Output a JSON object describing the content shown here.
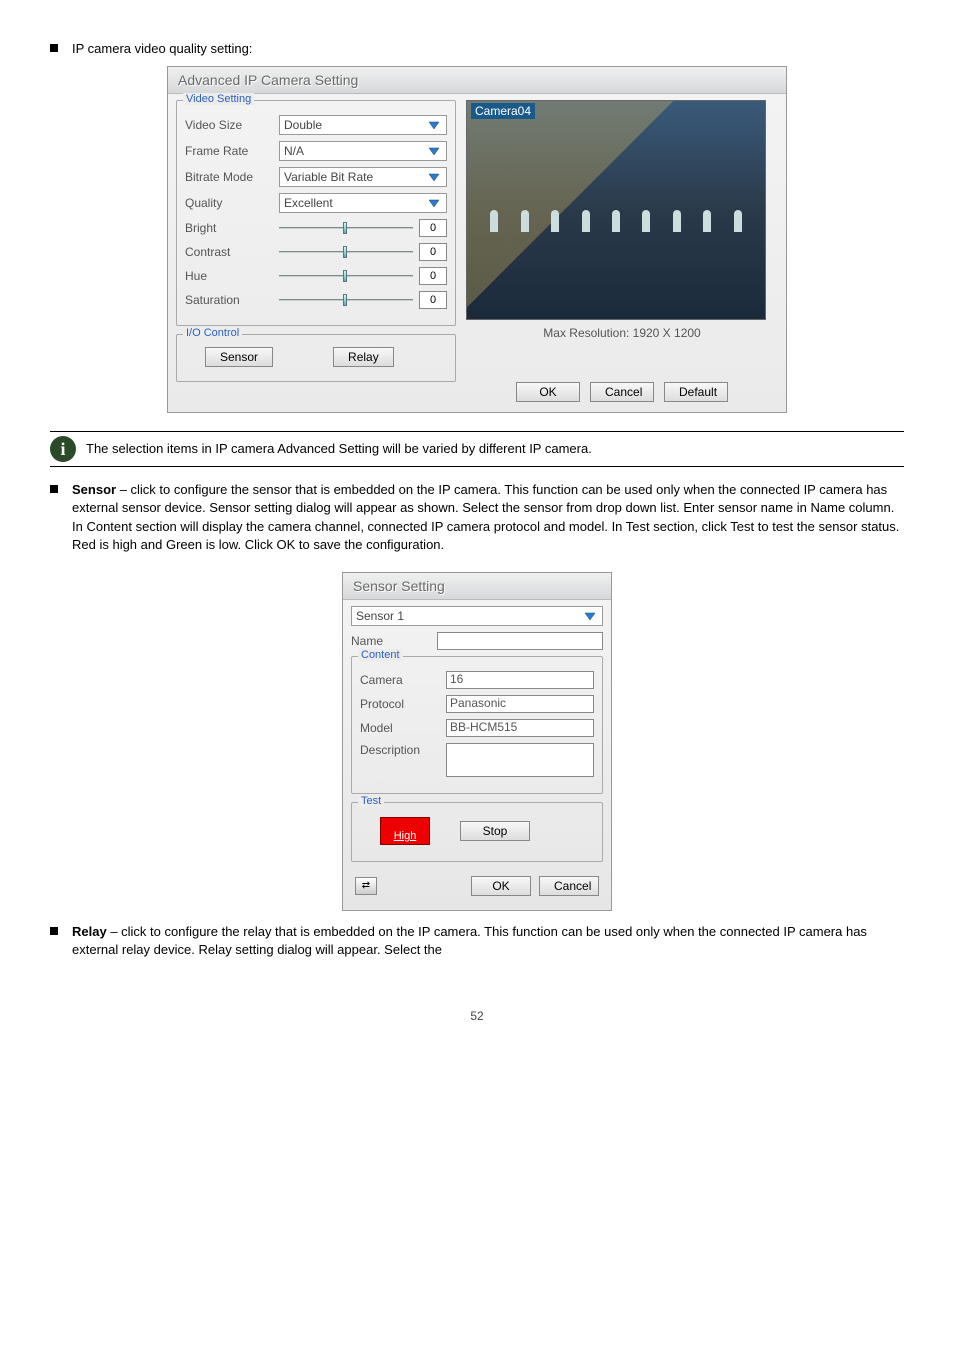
{
  "bullets": {
    "b1": "IP camera video quality setting:",
    "b3_prefix": "Sensor",
    "b3_text": " – click to configure the sensor that is embedded on the IP camera. This function can be used only when the connected IP camera has external sensor device. Sensor setting dialog will appear as shown. Select the sensor from drop down list. Enter sensor name in Name column. In Content section will display the camera channel, connected IP camera protocol and model. In Test section, click Test to test the sensor status. Red is high and Green is low. Click OK to save the configuration.",
    "b4_prefix": "Relay",
    "b4_text": " – click to configure the relay that is embedded on the IP camera. This function can be used only when the connected IP camera has external relay device. Relay setting dialog will appear. Select the"
  },
  "note": "The selection items in IP camera Advanced Setting will be varied by different IP camera.",
  "dialog1": {
    "title": "Advanced IP Camera Setting",
    "videoSetting": {
      "legend": "Video Setting",
      "rows": {
        "videoSizeLabel": "Video Size",
        "videoSize": "Double",
        "frameRateLabel": "Frame Rate",
        "frameRate": "N/A",
        "bitrateModeLabel": "Bitrate Mode",
        "bitrateMode": "Variable Bit Rate",
        "qualityLabel": "Quality",
        "quality": "Excellent"
      },
      "sliders": {
        "brightLabel": "Bright",
        "brightVal": "0",
        "contrastLabel": "Contrast",
        "contrastVal": "0",
        "hueLabel": "Hue",
        "hueVal": "0",
        "saturationLabel": "Saturation",
        "saturationVal": "0"
      }
    },
    "ioControl": {
      "legend": "I/O Control",
      "sensor": "Sensor",
      "relay": "Relay"
    },
    "preview": {
      "camLabel": "Camera04",
      "maxRes": "Max Resolution: 1920 X 1200"
    },
    "buttons": {
      "ok": "OK",
      "cancel": "Cancel",
      "default": "Default"
    }
  },
  "dialog2": {
    "title": "Sensor Setting",
    "sensorSelect": "Sensor 1",
    "nameLabel": "Name",
    "nameValue": "",
    "content": {
      "legend": "Content",
      "cameraLabel": "Camera",
      "camera": "16",
      "protocolLabel": "Protocol",
      "protocol": "Panasonic",
      "modelLabel": "Model",
      "model": "BB-HCM515",
      "descLabel": "Description",
      "desc": ""
    },
    "test": {
      "legend": "Test",
      "status": "High",
      "stop": "Stop"
    },
    "buttons": {
      "ok": "OK",
      "cancel": "Cancel"
    }
  },
  "pageNumber": "52"
}
